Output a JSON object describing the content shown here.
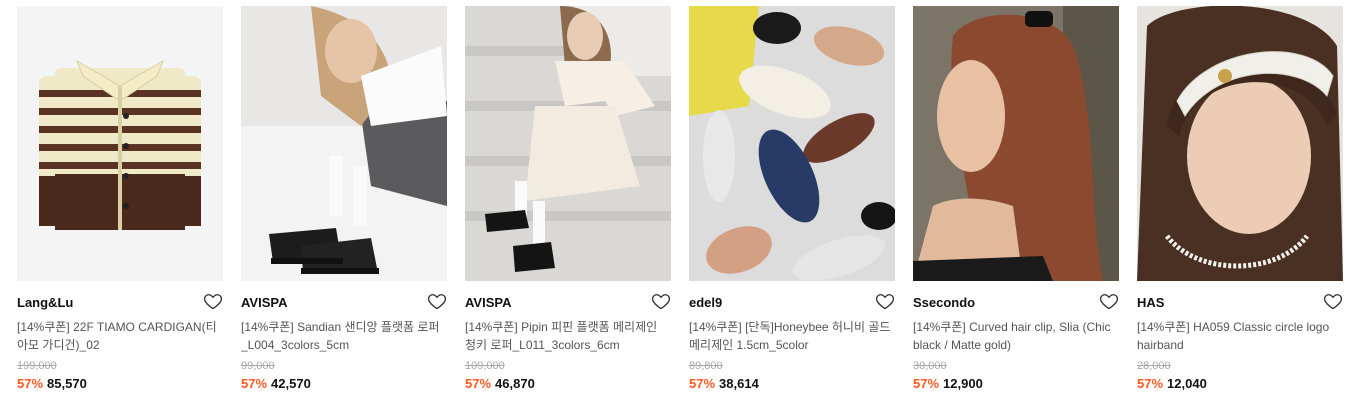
{
  "products": [
    {
      "brand": "Lang&Lu",
      "title": "[14%쿠폰] 22F TIAMO CARDIGAN(티아모 가디건)_02",
      "original_price": "199,000",
      "discount": "57%",
      "price": "85,570",
      "image_icon": "striped-cardigan-image"
    },
    {
      "brand": "AVISPA",
      "title": "[14%쿠폰] Sandian 샌디앙 플랫폼 로퍼_L004_3colors_5cm",
      "original_price": "99,000",
      "discount": "57%",
      "price": "42,570",
      "image_icon": "loafer-model-image"
    },
    {
      "brand": "AVISPA",
      "title": "[14%쿠폰] Pipin 피핀 플랫폼 메리제인 청키 로퍼_L011_3colors_6cm",
      "original_price": "109,000",
      "discount": "57%",
      "price": "46,870",
      "image_icon": "mary-jane-model-image"
    },
    {
      "brand": "edel9",
      "title": "[14%쿠폰] [단독]Honeybee 허니비 골드 메리제인 1.5cm_5color",
      "original_price": "89,800",
      "discount": "57%",
      "price": "38,614",
      "image_icon": "flat-shoes-image"
    },
    {
      "brand": "Ssecondo",
      "title": "[14%쿠폰] Curved hair clip, Slia (Chic black / Matte gold)",
      "original_price": "30,000",
      "discount": "57%",
      "price": "12,900",
      "image_icon": "hair-clip-model-image"
    },
    {
      "brand": "HAS",
      "title": "[14%쿠폰] HA059 Classic circle logo hairband",
      "original_price": "28,000",
      "discount": "57%",
      "price": "12,040",
      "image_icon": "hairband-model-image"
    }
  ],
  "colors": {
    "discount": "#ff5a1f",
    "strike": "#a8a8a8",
    "brand": "#111111"
  }
}
